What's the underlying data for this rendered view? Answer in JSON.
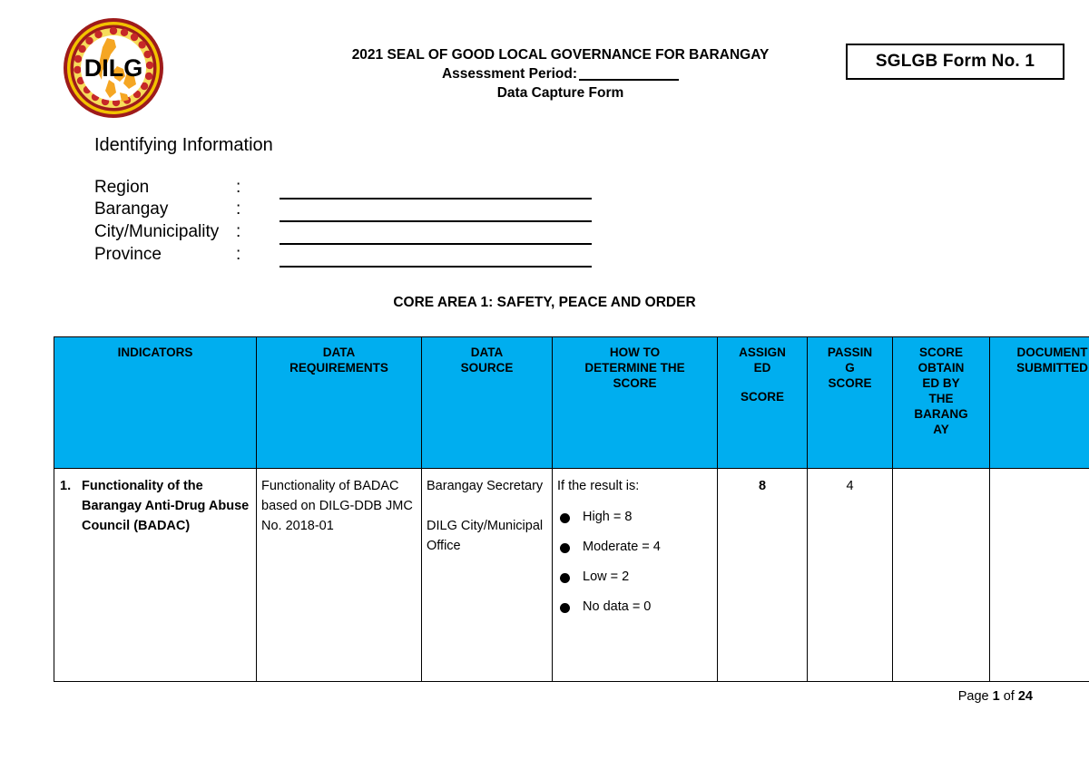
{
  "logo": {
    "name": "dilg-seal-logo",
    "acronym": "DILG",
    "colors": {
      "outer_ring": "#9E1B1B",
      "mid_ring": "#F2C200",
      "map": "#F5A623",
      "accent_red": "#C62828"
    }
  },
  "header": {
    "line1": "2021 SEAL OF GOOD LOCAL GOVERNANCE FOR BARANGAY",
    "line2_label": "Assessment Period:",
    "line2_value": "",
    "line3": "Data Capture Form",
    "form_no": "SGLGB Form No. 1"
  },
  "identifying_information": {
    "title": "Identifying Information",
    "colon": ":",
    "fields": [
      {
        "label": "Region",
        "value": ""
      },
      {
        "label": "Barangay",
        "value": ""
      },
      {
        "label": "City/Municipality",
        "value": ""
      },
      {
        "label": "Province",
        "value": ""
      }
    ]
  },
  "core_area": {
    "title": "CORE AREA 1:  SAFETY, PEACE AND ORDER"
  },
  "table": {
    "header_bg": "#00AEEF",
    "columns": [
      {
        "key": "indicators",
        "label_lines": [
          "INDICATORS"
        ]
      },
      {
        "key": "data_requirements",
        "label_lines": [
          "DATA",
          "REQUIREMENTS"
        ]
      },
      {
        "key": "data_source",
        "label_lines": [
          "DATA",
          "SOURCE"
        ]
      },
      {
        "key": "how_to_determine",
        "label_lines": [
          "HOW TO",
          "DETERMINE THE",
          "SCORE"
        ]
      },
      {
        "key": "assigned_score",
        "label_lines": [
          "ASSIGN",
          "ED",
          "",
          "SCORE"
        ]
      },
      {
        "key": "passing_score",
        "label_lines": [
          "PASSIN",
          "G",
          "SCORE"
        ]
      },
      {
        "key": "score_obtained",
        "label_lines": [
          "SCORE",
          "OBTAIN",
          "ED BY",
          "THE",
          "BARANG",
          "AY"
        ]
      },
      {
        "key": "document_submitted",
        "label_lines": [
          "DOCUMENT",
          "SUBMITTED"
        ]
      }
    ],
    "rows": [
      {
        "number": "1.",
        "indicator": "Functionality of the Barangay Anti-Drug Abuse Council (BADAC)",
        "data_requirements": "Functionality of BADAC based on DILG-DDB JMC No. 2018-01",
        "data_source_1": "Barangay Secretary",
        "data_source_2": "DILG City/Municipal Office",
        "how_to_intro": "If the result is:",
        "how_to_items": [
          "High = 8",
          "Moderate = 4",
          "Low = 2",
          "No data = 0"
        ],
        "assigned_score": "8",
        "passing_score": "4",
        "score_obtained": "",
        "document_submitted": ""
      }
    ]
  },
  "footer": {
    "prefix": "Page",
    "current_page": "1",
    "separator": "of",
    "total_pages": "24"
  }
}
